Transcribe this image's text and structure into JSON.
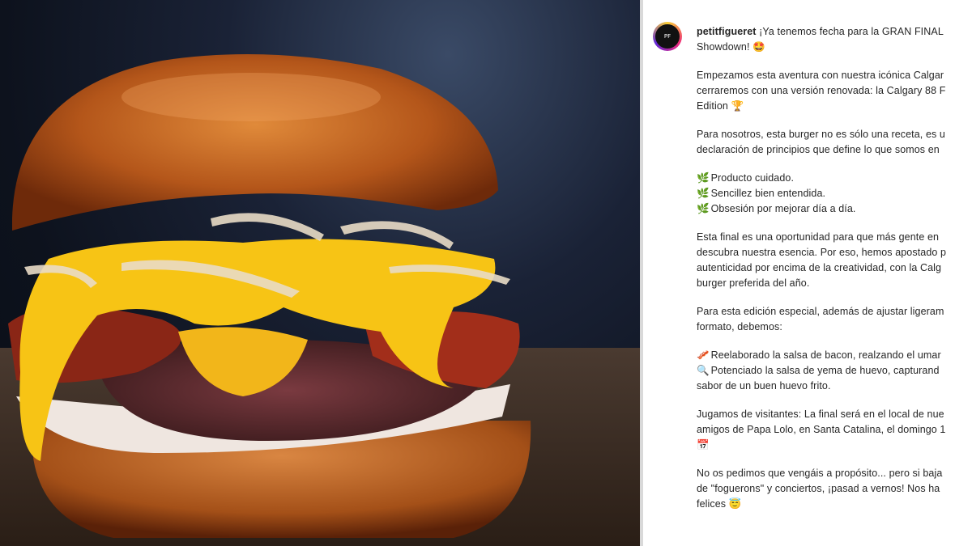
{
  "post": {
    "username": "petitfigueret",
    "avatar_text": "PF",
    "header_text": " ¡Ya tenemos fecha para la GRAN FINAL",
    "header_line2": "Showdown! 🤩",
    "p1": [
      "Empezamos esta aventura con nuestra icónica Calgar",
      "cerraremos con una versión renovada: la Calgary 88 F",
      "Edition 🏆"
    ],
    "p2": [
      "Para nosotros, esta burger no es sólo una receta, es u",
      "declaración de principios que define lo que somos en"
    ],
    "bullets": [
      {
        "icon": "🌿",
        "text": "Producto cuidado."
      },
      {
        "icon": "🌿",
        "text": "Sencillez bien entendida."
      },
      {
        "icon": "🌿",
        "text": "Obsesión por mejorar día a día."
      }
    ],
    "p3": [
      "Esta final es una oportunidad para que más gente en",
      "descubra nuestra esencia. Por eso, hemos apostado p",
      "autenticidad por encima de la creatividad, con la Calg",
      "burger preferida del año."
    ],
    "p4": [
      "Para esta edición especial, además de ajustar ligeram",
      "formato, debemos:"
    ],
    "changes": [
      {
        "icon": "🥓",
        "text": "Reelaborado la salsa de bacon, realzando el umar"
      },
      {
        "icon": "🔍",
        "text": "Potenciado la salsa de yema de huevo, capturand"
      }
    ],
    "changes_cont": "sabor de un buen huevo frito.",
    "p5": [
      "Jugamos de visitantes: La final será en el local de nue",
      "amigos de Papa Lolo, en Santa Catalina, el domingo 1"
    ],
    "p5_icon": "📅",
    "p6": [
      "No os pedimos que vengáis a propósito... pero si baja",
      "de \"foguerons\" y conciertos, ¡pasad a vernos! Nos ha",
      "felices 😇"
    ]
  }
}
